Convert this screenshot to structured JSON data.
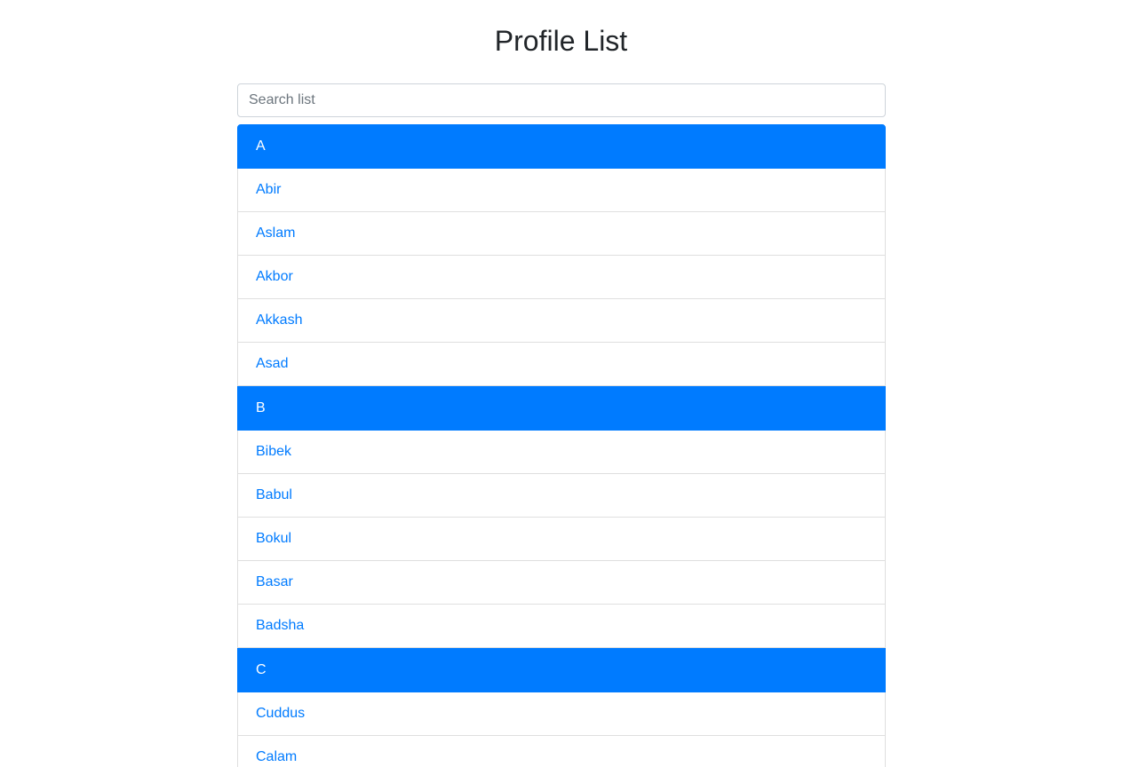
{
  "page": {
    "title": "Profile List"
  },
  "search": {
    "placeholder": "Search list",
    "value": ""
  },
  "groups": [
    {
      "letter": "A",
      "items": [
        "Abir",
        "Aslam",
        "Akbor",
        "Akkash",
        "Asad"
      ]
    },
    {
      "letter": "B",
      "items": [
        "Bibek",
        "Babul",
        "Bokul",
        "Basar",
        "Badsha"
      ]
    },
    {
      "letter": "C",
      "items": [
        "Cuddus",
        "Calam"
      ]
    }
  ],
  "colors": {
    "accent": "#007bff",
    "border": "#dfdfdf",
    "title": "#212529"
  }
}
